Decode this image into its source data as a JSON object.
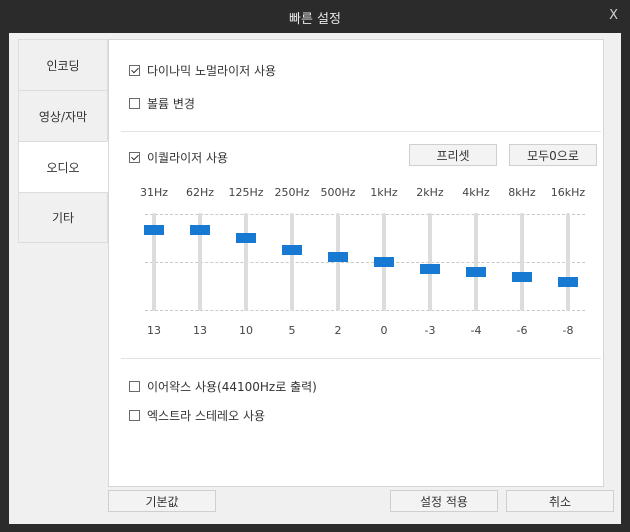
{
  "window": {
    "title": "빠른 설정",
    "close_label": "X"
  },
  "tabs": [
    {
      "label": "인코딩",
      "active": false
    },
    {
      "label": "영상/자막",
      "active": false
    },
    {
      "label": "오디오",
      "active": true
    },
    {
      "label": "기타",
      "active": false
    }
  ],
  "audio": {
    "normalizer": {
      "label": "다이나믹 노멀라이저 사용",
      "checked": true
    },
    "volume_change": {
      "label": "볼륨 변경",
      "checked": false
    },
    "equalizer": {
      "label": "이퀄라이저 사용",
      "checked": true
    },
    "preset_button": "프리셋",
    "reset_button": "모두0으로",
    "bands": [
      {
        "freq": "31Hz",
        "value": 13
      },
      {
        "freq": "62Hz",
        "value": 13
      },
      {
        "freq": "125Hz",
        "value": 10
      },
      {
        "freq": "250Hz",
        "value": 5
      },
      {
        "freq": "500Hz",
        "value": 2
      },
      {
        "freq": "1kHz",
        "value": 0
      },
      {
        "freq": "2kHz",
        "value": -3
      },
      {
        "freq": "4kHz",
        "value": -4
      },
      {
        "freq": "8kHz",
        "value": -6
      },
      {
        "freq": "16kHz",
        "value": -8
      }
    ],
    "band_range": [
      -20,
      20
    ],
    "earwax": {
      "label": "이어왁스 사용(44100Hz로 출력)",
      "checked": false
    },
    "extra_stereo": {
      "label": "엑스트라 스테레오 사용",
      "checked": false
    }
  },
  "footer": {
    "default_button": "기본값",
    "apply_button": "설정 적용",
    "cancel_button": "취소"
  },
  "colors": {
    "accent": "#1779d2",
    "titlebar": "#2b2b2b",
    "client_bg": "#f0f0f0"
  }
}
